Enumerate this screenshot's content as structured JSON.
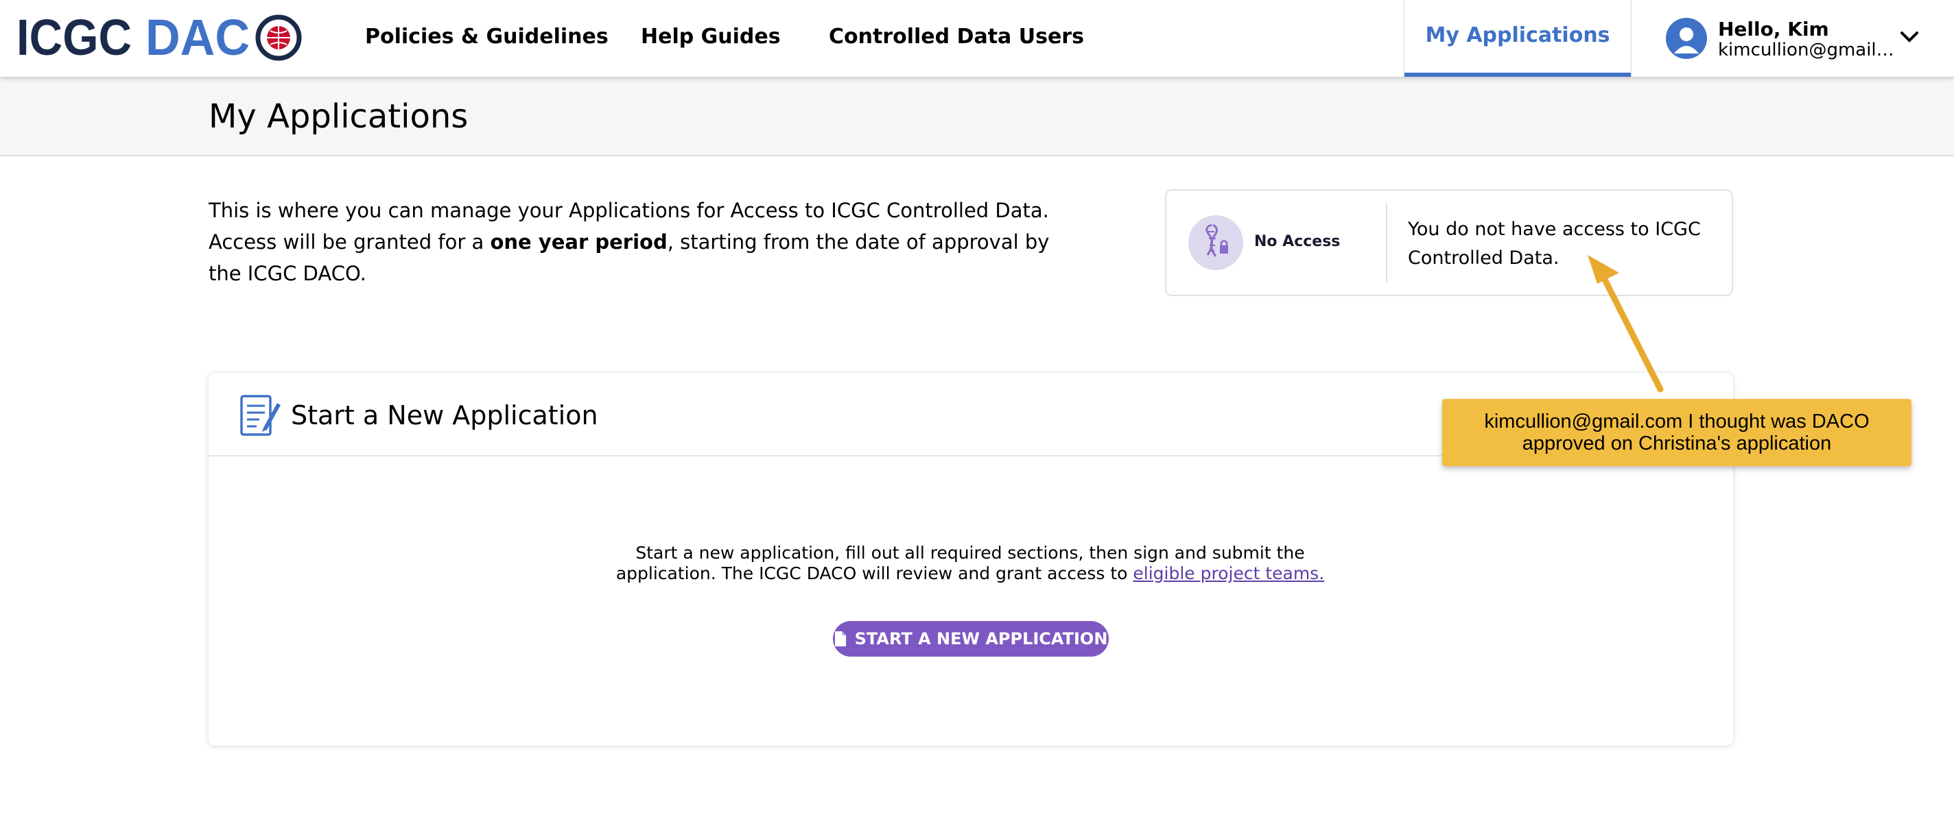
{
  "header": {
    "logo_text": "ICGC DACO",
    "nav": [
      {
        "label": "Policies & Guidelines"
      },
      {
        "label": "Help Guides"
      },
      {
        "label": "Controlled Data Users"
      }
    ],
    "active_tab": "My Applications",
    "user": {
      "greeting": "Hello, Kim",
      "email": "kimcullion@gmail.com",
      "avatar_icon": "user-icon",
      "menu_icon": "chevron-down-icon"
    }
  },
  "page": {
    "title": "My Applications",
    "intro": {
      "part1": "This is where you can manage your Applications for Access to ICGC Controlled Data. Access will be granted for a ",
      "bold": "one year period",
      "part2": ", starting from the date of approval by the ICGC DACO."
    }
  },
  "access_card": {
    "icon": "dna-lock-icon",
    "status": "No Access",
    "message": "You do not have access to ICGC Controlled Data."
  },
  "start_card": {
    "icon": "document-edit-icon",
    "title": "Start a New Application",
    "description": "Start a new application, fill out all required sections, then sign and submit the application. The ICGC DACO will review and grant access to ",
    "link_text": "eligible project teams.",
    "button_label": "START A NEW APPLICATION",
    "button_icon": "file-icon"
  },
  "annotation": {
    "text": "kimcullion@gmail.com I thought was DACO approved on Christina's application"
  },
  "colors": {
    "brand_blue": "#3f72c7",
    "logo_navy": "#1b2a4a",
    "button_purple": "#7e58c2",
    "annotation_yellow": "#f2be42"
  }
}
